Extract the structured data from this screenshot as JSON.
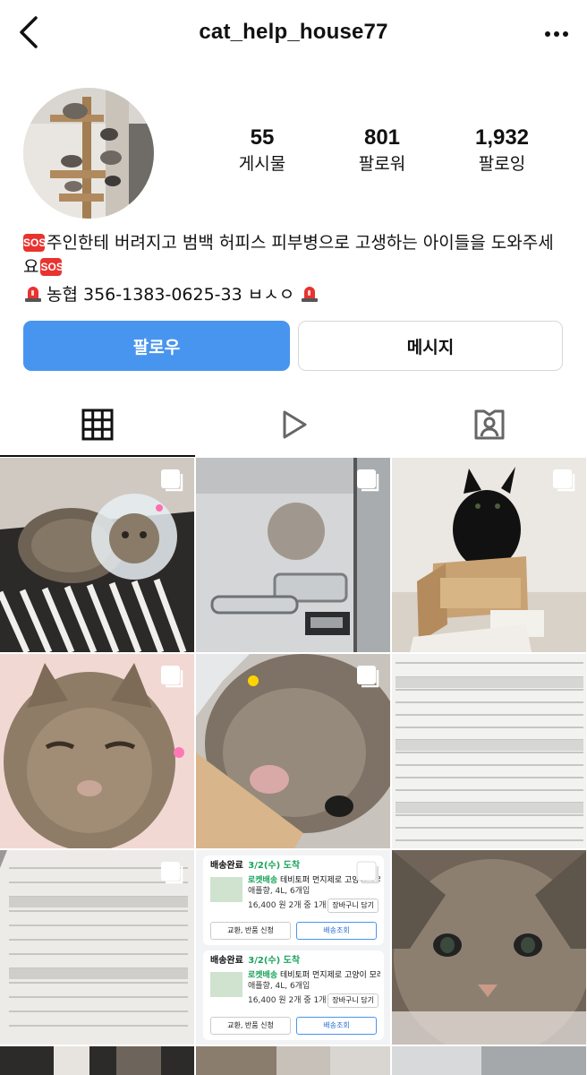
{
  "profile": {
    "username": "cat_help_house77"
  },
  "stats": {
    "posts": {
      "value": "55",
      "label": "게시물"
    },
    "followers": {
      "value": "801",
      "label": "팔로워"
    },
    "following": {
      "value": "1,932",
      "label": "팔로잉"
    }
  },
  "bio": {
    "sos_badge": "SOS",
    "line1": "주인한테 버려지고 범백 허피스 피부병으로 고생하는 아이들을 도와주세요",
    "line2": "농협 356-1383-0625-33 ㅂㅅㅇ"
  },
  "actions": {
    "follow_label": "팔로우",
    "message_label": "메시지"
  },
  "tabs": [
    {
      "icon": "grid-icon",
      "active": true
    },
    {
      "icon": "reels-play-icon",
      "active": false
    },
    {
      "icon": "tagged-person-icon",
      "active": false
    }
  ],
  "posts": {
    "shipping_card": {
      "status": "배송완료",
      "date": "3/2(수) 도착",
      "brand": "로켓배송",
      "product_line1": "테비토퍼 먼지제로 고양이 모래",
      "product_line2": "애플향, 4L, 6개입",
      "price": "16,400 원",
      "qty": "2개 중 1개",
      "cart_btn": "장바구니 담기",
      "return_btn": "교환, 반품 신청",
      "track_btn": "배송조회"
    }
  },
  "colors": {
    "accent": "#4895ef",
    "sos_red": "#e8332f",
    "shipping_green": "#1aa35a"
  }
}
